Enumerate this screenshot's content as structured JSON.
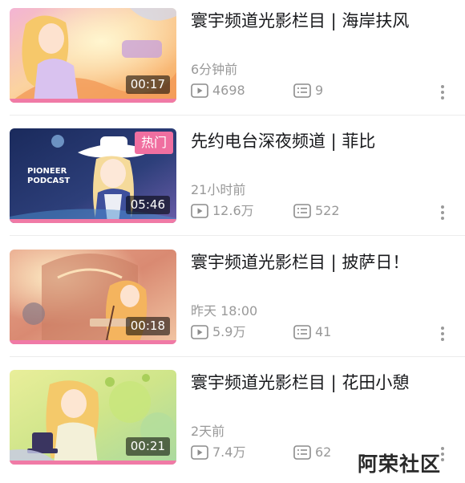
{
  "videos": [
    {
      "title": "寰宇频道光影栏目 | 海岸扶风",
      "time": "6分钟前",
      "duration": "00:17",
      "views": "4698",
      "comments": "9",
      "hot_tag": ""
    },
    {
      "title": "先约电台深夜频道 | 菲比",
      "time": "21小时前",
      "duration": "05:46",
      "views": "12.6万",
      "comments": "522",
      "hot_tag": "热门",
      "thumb_text": [
        "PIONEER",
        "PODCAST"
      ]
    },
    {
      "title": "寰宇频道光影栏目 | 披萨日！",
      "time": "昨天 18:00",
      "duration": "00:18",
      "views": "5.9万",
      "comments": "41",
      "hot_tag": ""
    },
    {
      "title": "寰宇频道光影栏目  | 花田小憩",
      "time": "2天前",
      "duration": "00:21",
      "views": "7.4万",
      "comments": "62",
      "hot_tag": ""
    }
  ],
  "icons": {
    "views": "play-icon",
    "comments": "danmaku-icon",
    "more": "more-vertical-icon"
  },
  "colors": {
    "accent_pink": "#f07aa6",
    "hot_tag": "#f06fa0",
    "meta_gray": "#999999"
  },
  "watermark": "阿荣社区"
}
